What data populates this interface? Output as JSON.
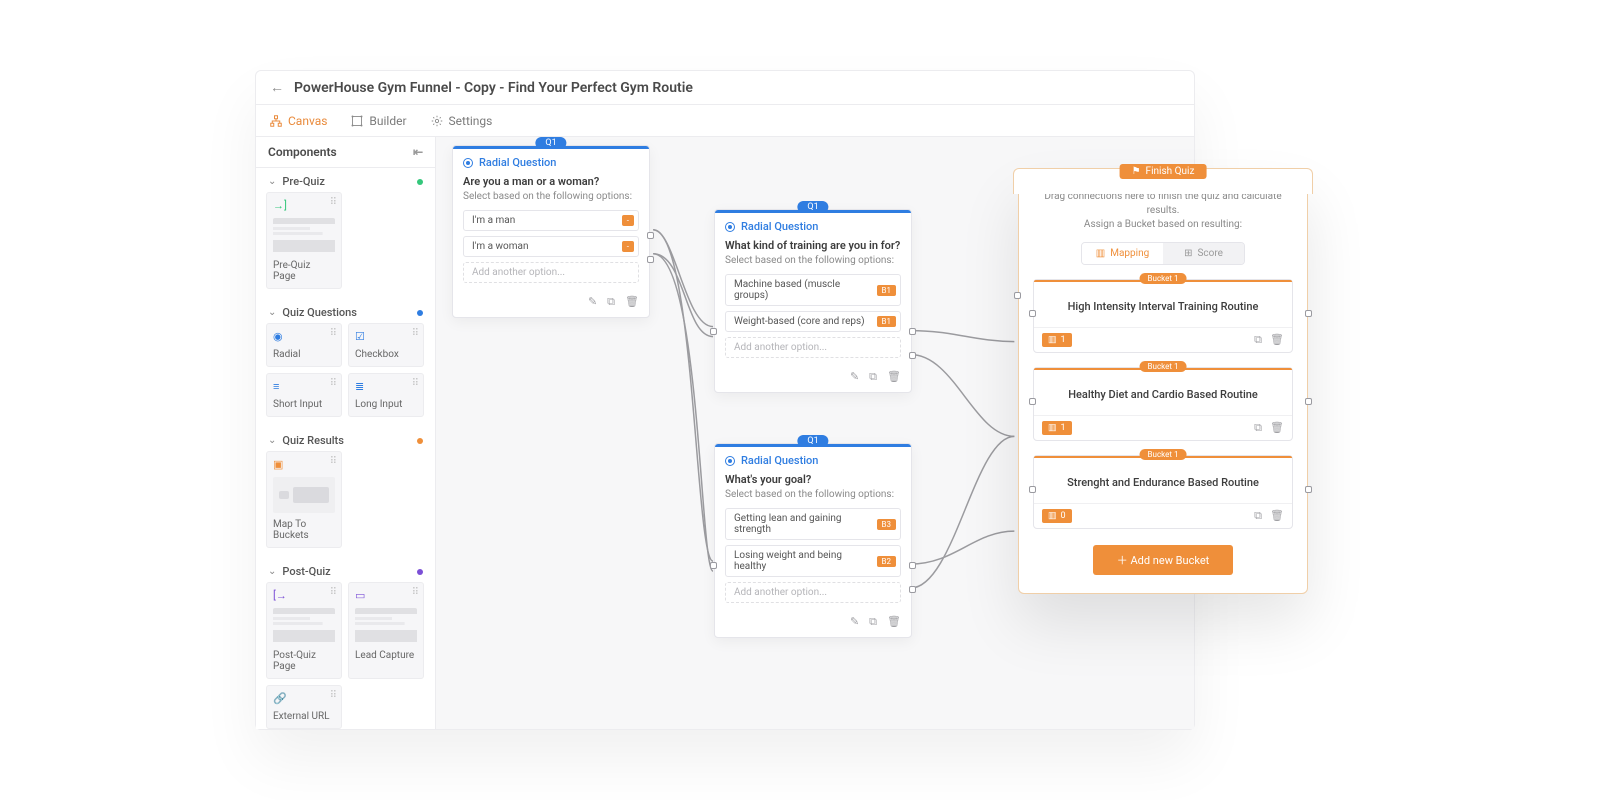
{
  "header": {
    "title": "PowerHouse Gym Funnel - Copy - Find Your Perfect Gym Routie"
  },
  "tabs": {
    "canvas": "Canvas",
    "builder": "Builder",
    "settings": "Settings"
  },
  "sidebar": {
    "title": "Components",
    "sections": {
      "prequiz": {
        "label": "Pre-Quiz",
        "items": [
          "Pre-Quiz Page"
        ]
      },
      "questions": {
        "label": "Quiz Questions",
        "items": [
          "Radial",
          "Checkbox",
          "Short Input",
          "Long Input"
        ]
      },
      "results": {
        "label": "Quiz Results",
        "items": [
          "Map To Buckets"
        ]
      },
      "postquiz": {
        "label": "Post-Quiz",
        "items": [
          "Post-Quiz Page",
          "Lead Capture",
          "External URL"
        ]
      }
    }
  },
  "nodes": {
    "type_label": "Radial Question",
    "subtitle": "Select based on the following options:",
    "add_option": "Add another option...",
    "tag": "Q1",
    "q1": {
      "question": "Are you a man or a woman?",
      "opts": [
        {
          "text": "I'm a man",
          "badge": "-"
        },
        {
          "text": "I'm a woman",
          "badge": "-"
        }
      ]
    },
    "q2": {
      "question": "What kind of training are you in for?",
      "opts": [
        {
          "text": "Machine based (muscle groups)",
          "badge": "B1"
        },
        {
          "text": "Weight-based (core and reps)",
          "badge": "B1"
        }
      ]
    },
    "q3": {
      "question": "What's your goal?",
      "opts": [
        {
          "text": "Getting lean and gaining strength",
          "badge": "B3"
        },
        {
          "text": "Losing weight and being healthy",
          "badge": "B2"
        }
      ]
    }
  },
  "finish": {
    "tag": "Finish Quiz",
    "help1": "Drag connections here to finish the quiz and calculate results.",
    "help2": "Assign a Bucket based on resulting:",
    "seg": {
      "mapping": "Mapping",
      "score": "Score"
    },
    "bucket_tag": "Bucket 1",
    "buckets": [
      {
        "title": "High Intensity Interval Training Routine",
        "count": "1"
      },
      {
        "title": "Healthy Diet and Cardio Based Routine",
        "count": "1"
      },
      {
        "title": "Strenght and Endurance Based Routine",
        "count": "0"
      }
    ],
    "add": "Add new Bucket"
  }
}
